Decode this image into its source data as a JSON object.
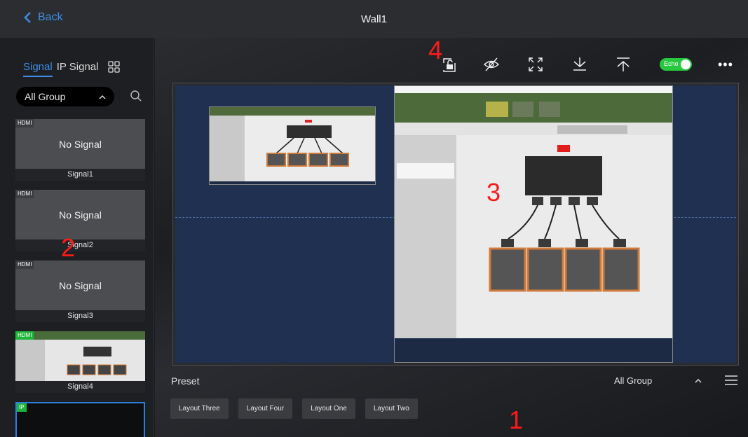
{
  "header": {
    "back_label": "Back",
    "title": "Wall1"
  },
  "sidebar": {
    "tabs": [
      {
        "label": "Signal"
      },
      {
        "label": "IP Signal"
      }
    ],
    "group_select": {
      "value": "All Group"
    },
    "signals": [
      {
        "badge": "HDMI",
        "status": "No Signal",
        "name": "Signal1"
      },
      {
        "badge": "HDMI",
        "status": "No Signal",
        "name": "Signal2"
      },
      {
        "badge": "HDMI",
        "status": "No Signal",
        "name": "Signal3"
      },
      {
        "badge": "HDMI",
        "status": "",
        "name": "Signal4"
      },
      {
        "badge": "IP",
        "status": "",
        "name": ""
      }
    ]
  },
  "toolbar": {
    "echo_label": "Echo",
    "echo_on": true
  },
  "preset": {
    "label": "Preset",
    "group_value": "All Group",
    "layouts": [
      "Layout Three",
      "Layout Four",
      "Layout One",
      "Layout Two"
    ]
  },
  "annotations": {
    "m1": "1",
    "m2": "2",
    "m3": "3",
    "m4": "4"
  },
  "colors": {
    "accent": "#3e8de6",
    "echo_on": "#29c640",
    "annotation": "#ff1a1a",
    "wall_bg": "#1f3050"
  }
}
